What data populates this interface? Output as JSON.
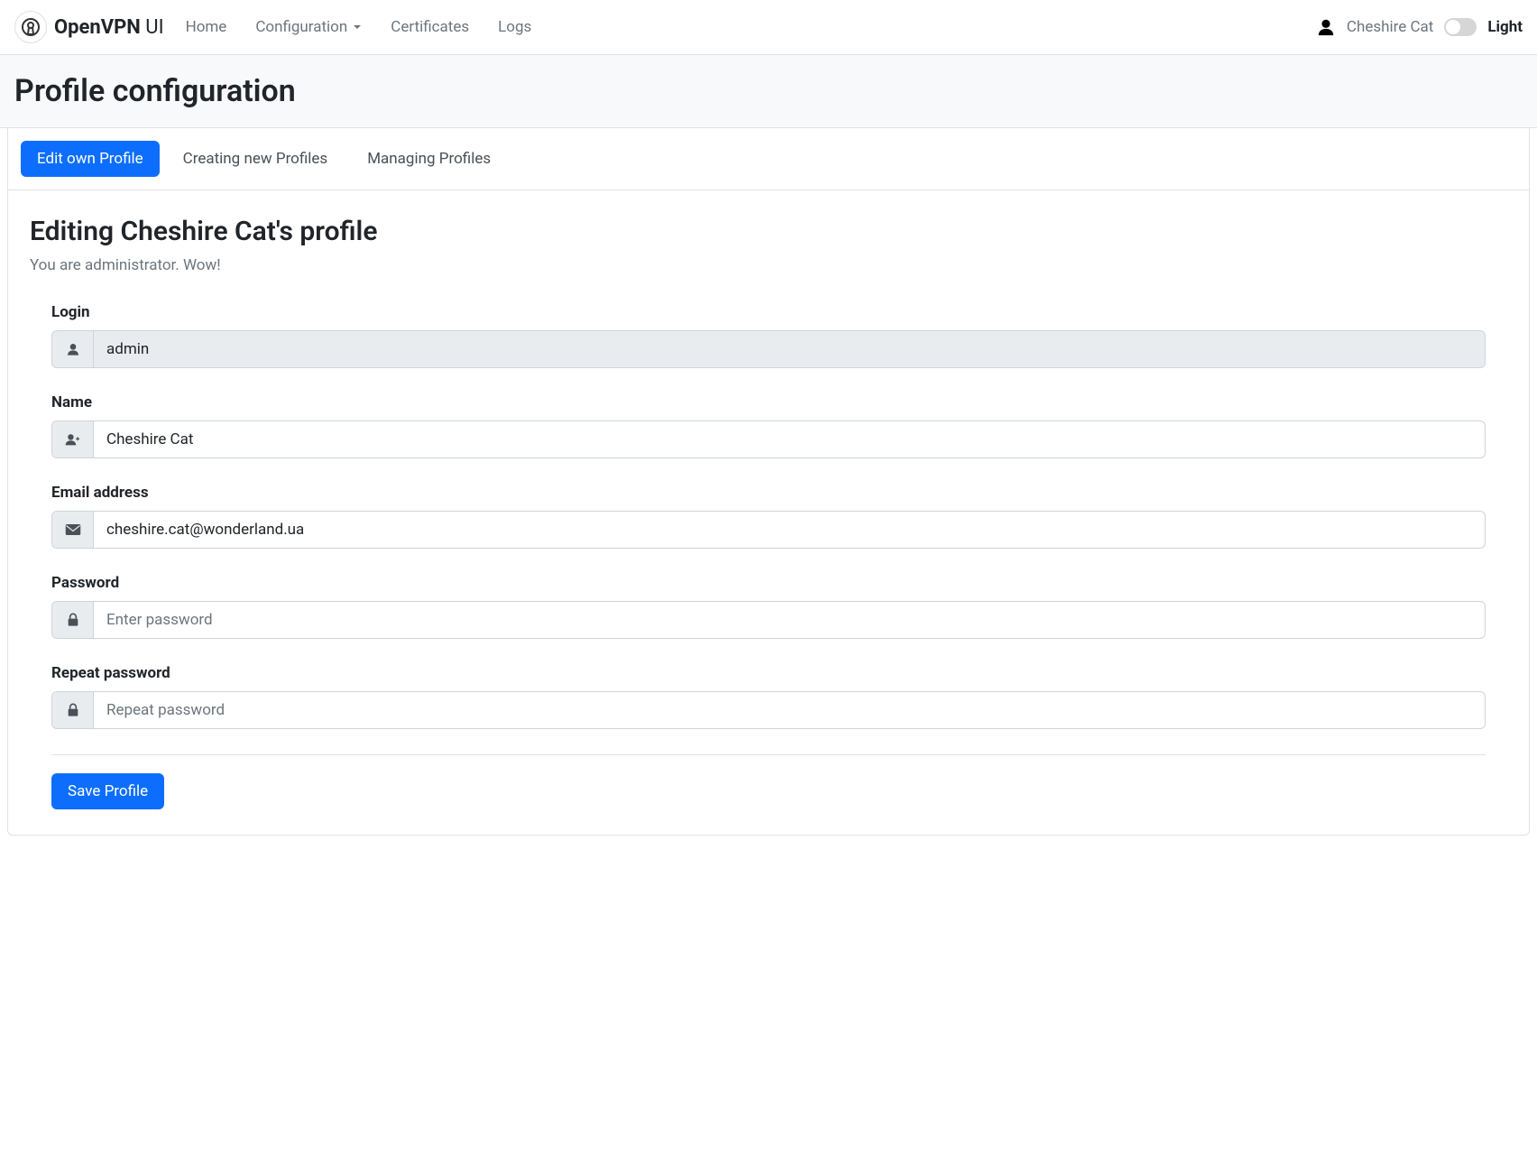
{
  "brand": {
    "bold": "OpenVPN",
    "light": " UI"
  },
  "nav": {
    "home": "Home",
    "configuration": "Configuration",
    "certificates": "Certificates",
    "logs": "Logs"
  },
  "user": {
    "name": "Cheshire Cat"
  },
  "theme": {
    "label": "Light"
  },
  "page": {
    "title": "Profile configuration"
  },
  "tabs": {
    "edit_own": "Edit own Profile",
    "create_new": "Creating new Profiles",
    "manage": "Managing Profiles"
  },
  "panel": {
    "heading": "Editing Cheshire Cat's profile",
    "subtext": "You are administrator. Wow!"
  },
  "form": {
    "login": {
      "label": "Login",
      "value": "admin"
    },
    "name": {
      "label": "Name",
      "value": "Cheshire Cat"
    },
    "email": {
      "label": "Email address",
      "value": "cheshire.cat@wonderland.ua"
    },
    "password": {
      "label": "Password",
      "placeholder": "Enter password"
    },
    "repeat_password": {
      "label": "Repeat password",
      "placeholder": "Repeat password"
    },
    "save_button": "Save Profile"
  }
}
